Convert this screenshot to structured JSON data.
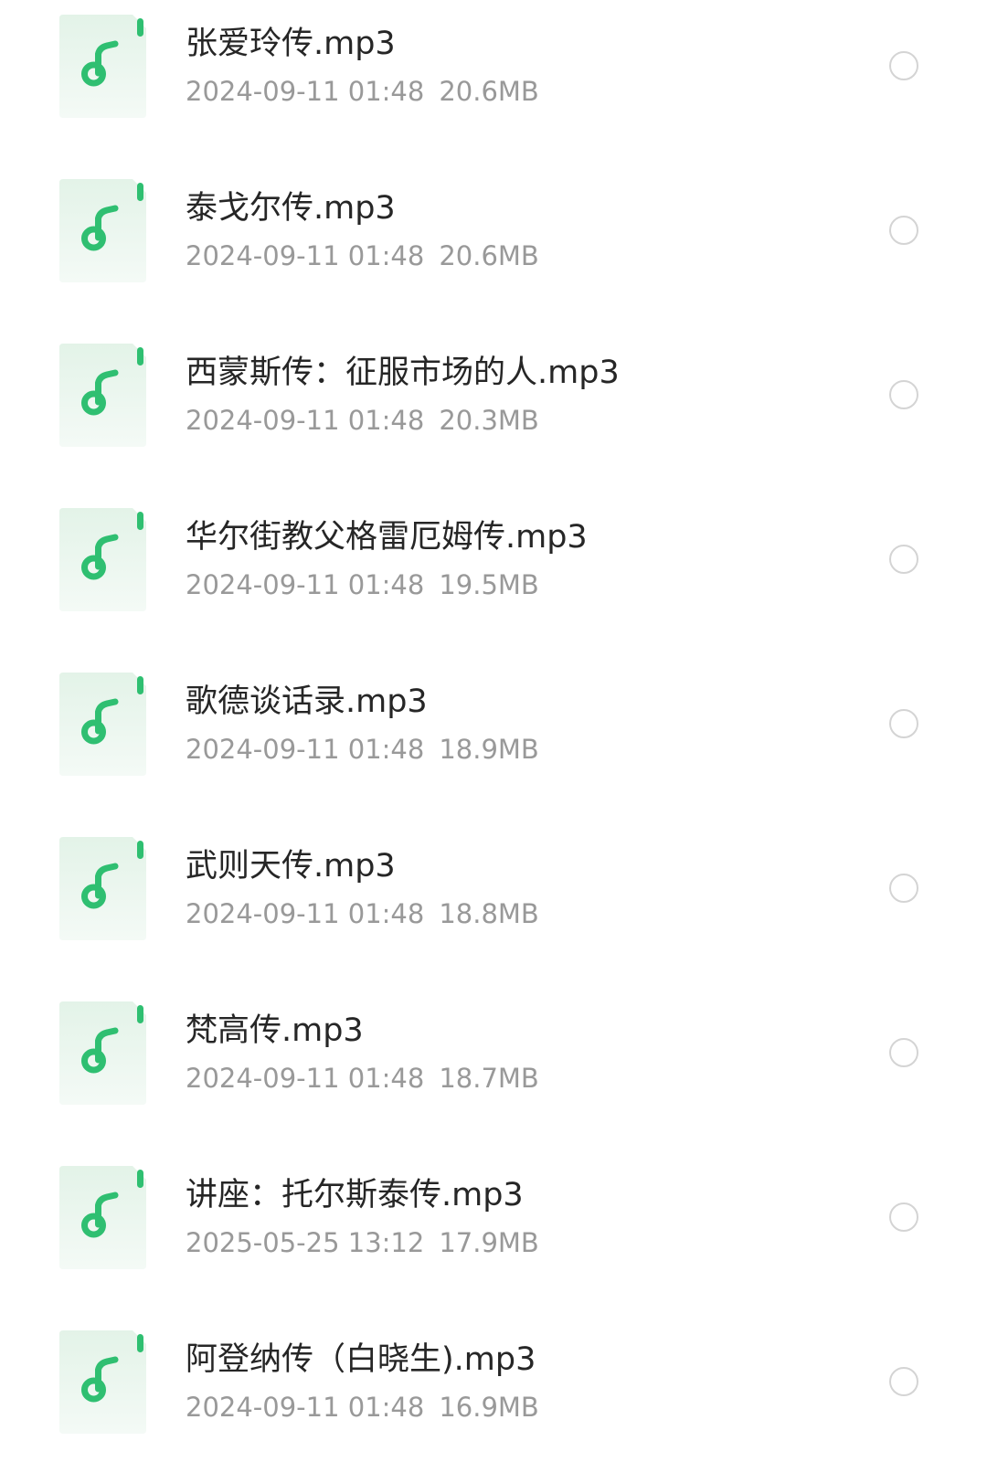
{
  "colors": {
    "icon_accent": "#2fbf71",
    "icon_bg": "#eef7f1",
    "title_text": "#262626",
    "meta_text": "#999999",
    "radio_border": "#d4d4d4"
  },
  "icons": {
    "file_type": "music-file-icon",
    "selector": "radio-unselected-icon"
  },
  "files": [
    {
      "name": "张爱玲传.mp3",
      "date": "2024-09-11 01:48",
      "size": "20.6MB",
      "selected": false
    },
    {
      "name": "泰戈尔传.mp3",
      "date": "2024-09-11 01:48",
      "size": "20.6MB",
      "selected": false
    },
    {
      "name": "西蒙斯传：征服市场的人.mp3",
      "date": "2024-09-11 01:48",
      "size": "20.3MB",
      "selected": false
    },
    {
      "name": "华尔街教父格雷厄姆传.mp3",
      "date": "2024-09-11 01:48",
      "size": "19.5MB",
      "selected": false
    },
    {
      "name": "歌德谈话录.mp3",
      "date": "2024-09-11 01:48",
      "size": "18.9MB",
      "selected": false
    },
    {
      "name": "武则天传.mp3",
      "date": "2024-09-11 01:48",
      "size": "18.8MB",
      "selected": false
    },
    {
      "name": "梵高传.mp3",
      "date": "2024-09-11 01:48",
      "size": "18.7MB",
      "selected": false
    },
    {
      "name": "讲座：托尔斯泰传.mp3",
      "date": "2025-05-25 13:12",
      "size": "17.9MB",
      "selected": false
    },
    {
      "name": "阿登纳传（白晓生).mp3",
      "date": "2024-09-11 01:48",
      "size": "16.9MB",
      "selected": false
    }
  ]
}
